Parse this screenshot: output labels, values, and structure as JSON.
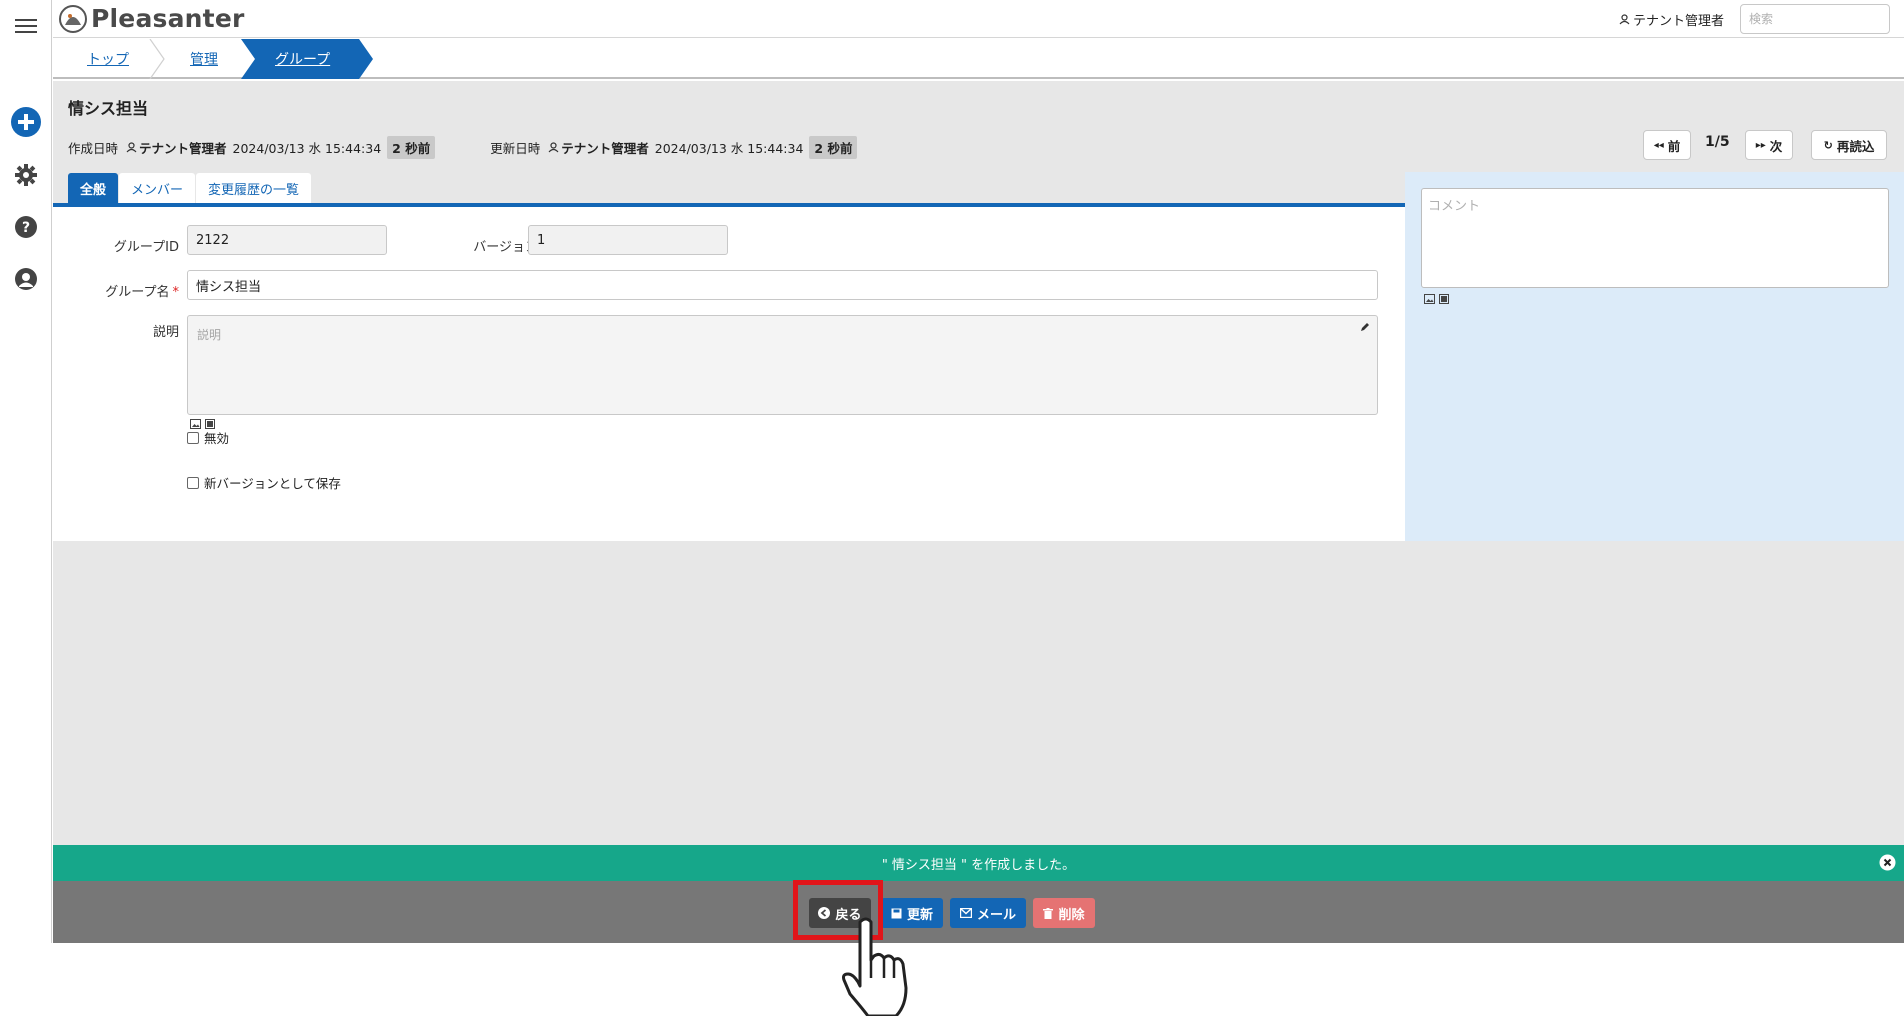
{
  "header": {
    "logo_text": "Pleasanter",
    "user_name": "テナント管理者",
    "search_placeholder": "検索"
  },
  "breadcrumb": {
    "items": [
      {
        "label": "トップ"
      },
      {
        "label": "管理"
      },
      {
        "label": "グループ"
      }
    ]
  },
  "page": {
    "title": "情シス担当",
    "created_label": "作成日時",
    "created_by": "テナント管理者",
    "created_at": "2024/03/13 水 15:44:34",
    "created_ago": "2 秒前",
    "updated_label": "更新日時",
    "updated_by": "テナント管理者",
    "updated_at": "2024/03/13 水 15:44:34",
    "updated_ago": "2 秒前",
    "prev_label": "前",
    "page_indicator": "1/5",
    "next_label": "次",
    "reload_label": "再読込"
  },
  "tabs": [
    {
      "label": "全般",
      "active": true
    },
    {
      "label": "メンバー",
      "active": false
    },
    {
      "label": "変更履歴の一覧",
      "active": false
    }
  ],
  "form": {
    "group_id_label": "グループID",
    "group_id_value": "2122",
    "version_label": "バージョン",
    "version_value": "1",
    "group_name_label": "グループ名",
    "required_mark": "*",
    "group_name_value": "情シス担当",
    "description_label": "説明",
    "description_placeholder": "説明",
    "disabled_label": "無効",
    "save_new_version_label": "新バージョンとして保存"
  },
  "comment": {
    "placeholder": "コメント"
  },
  "message": {
    "text": "\" 情シス担当 \" を作成しました。"
  },
  "actions": {
    "back_label": "戻る",
    "update_label": "更新",
    "mail_label": "メール",
    "delete_label": "削除"
  },
  "colors": {
    "accent_blue": "#1366b5",
    "message_green": "#16a78a",
    "delete_red": "#e57373",
    "highlight_red": "#e1151a"
  }
}
